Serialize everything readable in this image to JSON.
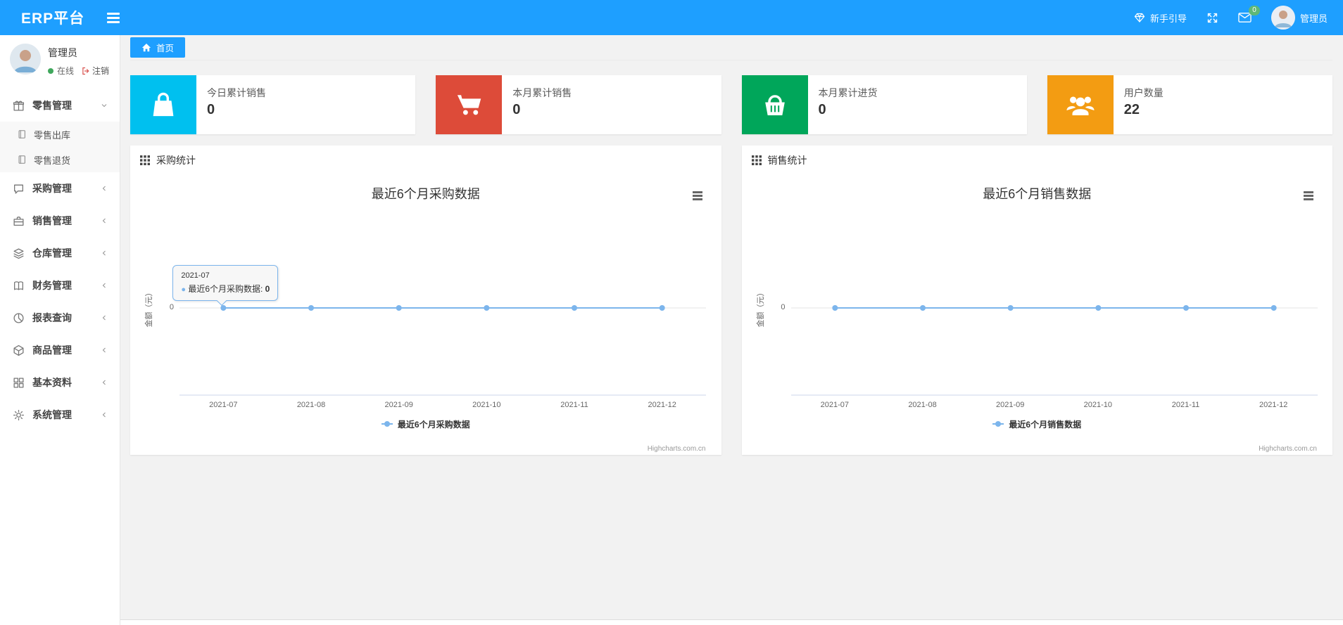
{
  "navbar": {
    "brand": "ERP平台",
    "guide_label": "新手引导",
    "mail_badge": "0",
    "user_name": "管理员",
    "accent_color": "#1E9FFF"
  },
  "sidebar": {
    "user": {
      "name": "管理员",
      "status": "在线",
      "logout": "注销"
    },
    "menu": [
      {
        "label": "零售管理",
        "expanded": true,
        "children": [
          {
            "label": "零售出库"
          },
          {
            "label": "零售退货"
          }
        ]
      },
      {
        "label": "采购管理"
      },
      {
        "label": "销售管理"
      },
      {
        "label": "仓库管理"
      },
      {
        "label": "财务管理"
      },
      {
        "label": "报表查询"
      },
      {
        "label": "商品管理"
      },
      {
        "label": "基本资料"
      },
      {
        "label": "系统管理"
      }
    ]
  },
  "tabs": {
    "home": "首页"
  },
  "stat_cards": [
    {
      "label": "今日累计销售",
      "value": "0",
      "color": "#00c0ef",
      "icon": "shopping-bag-icon"
    },
    {
      "label": "本月累计销售",
      "value": "0",
      "color": "#dd4b39",
      "icon": "shopping-cart-icon"
    },
    {
      "label": "本月累计进货",
      "value": "0",
      "color": "#00a65a",
      "icon": "shopping-basket-icon"
    },
    {
      "label": "用户数量",
      "value": "22",
      "color": "#f39c12",
      "icon": "users-icon"
    }
  ],
  "panels": [
    {
      "title": "采购统计"
    },
    {
      "title": "销售统计"
    }
  ],
  "chart_data": [
    {
      "type": "line",
      "title": "最近6个月采购数据",
      "categories": [
        "2021-07",
        "2021-08",
        "2021-09",
        "2021-10",
        "2021-11",
        "2021-12"
      ],
      "series": [
        {
          "name": "最近6个月采购数据",
          "values": [
            0,
            0,
            0,
            0,
            0,
            0
          ]
        }
      ],
      "ylabel": "金额（元）",
      "yticks": [
        "0"
      ],
      "ylim": [
        -1,
        1
      ],
      "grid": "minimal",
      "legend_position": "bottom",
      "line_color": "#7cb5ec",
      "credits": "Highcharts.com.cn",
      "tooltip": {
        "visible": true,
        "x_label": "2021-07",
        "series_name": "最近6个月采购数据",
        "value": "0",
        "point_index": 0
      }
    },
    {
      "type": "line",
      "title": "最近6个月销售数据",
      "categories": [
        "2021-07",
        "2021-08",
        "2021-09",
        "2021-10",
        "2021-11",
        "2021-12"
      ],
      "series": [
        {
          "name": "最近6个月销售数据",
          "values": [
            0,
            0,
            0,
            0,
            0,
            0
          ]
        }
      ],
      "ylabel": "金额（元）",
      "yticks": [
        "0"
      ],
      "ylim": [
        -1,
        1
      ],
      "grid": "minimal",
      "legend_position": "bottom",
      "line_color": "#7cb5ec",
      "credits": "Highcharts.com.cn",
      "tooltip": {
        "visible": false
      }
    }
  ]
}
